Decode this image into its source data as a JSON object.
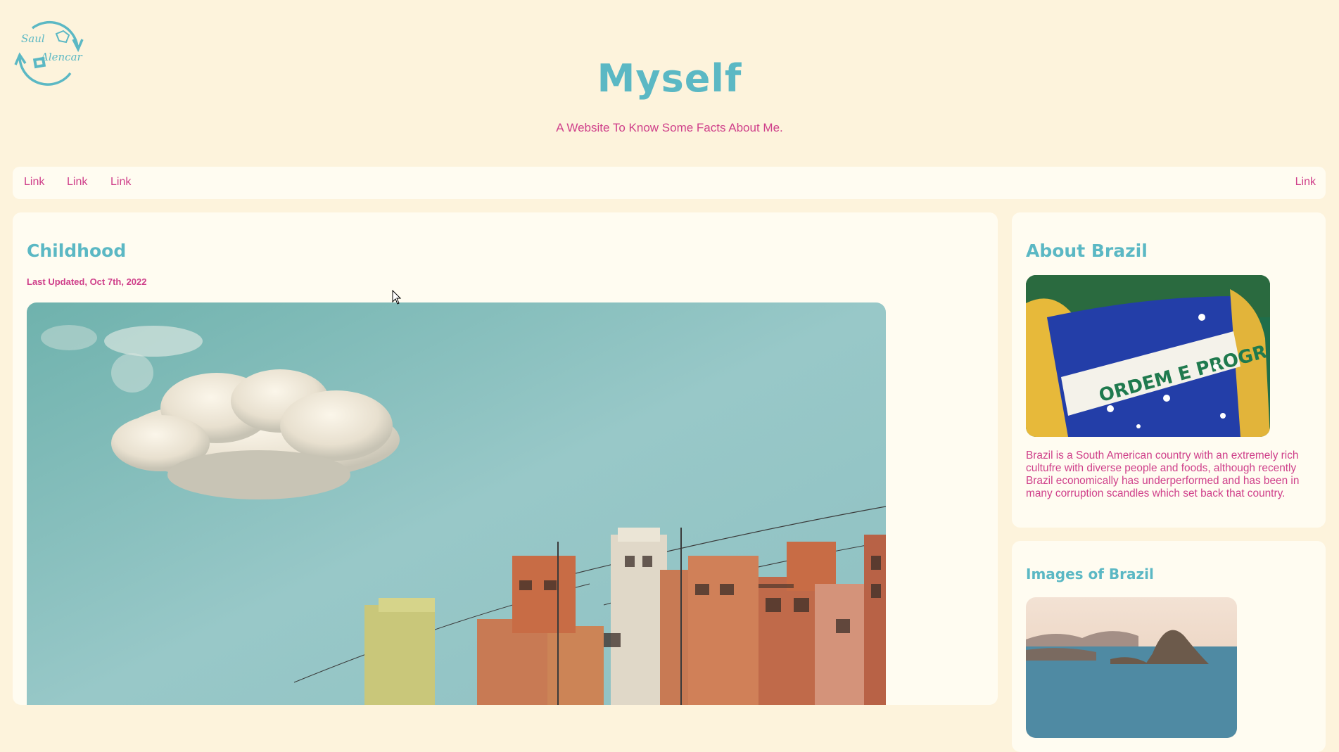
{
  "header": {
    "logo_text_top": "Saul",
    "logo_text_bottom": "Alencar",
    "title": "Myself",
    "subtitle": "A Website To Know Some Facts About Me."
  },
  "nav": {
    "links": [
      "Link",
      "Link",
      "Link"
    ],
    "right_link": "Link"
  },
  "main": {
    "title": "Childhood",
    "updated": "Last Updated, Oct 7th, 2022",
    "image": "hillside-houses-under-blue-sky-photo"
  },
  "sidebar": {
    "about": {
      "title": "About Brazil",
      "image": "brazilian-flag-photo",
      "flag_text": "ORDEM E PROGR",
      "text": "Brazil is a South American country with an extremely rich cultufre with diverse people and foods, although recently Brazil economically has underperformed and has been in many corruption scandles which set back that country."
    },
    "images": {
      "title": "Images of Brazil",
      "image": "rio-de-janeiro-bay-photo"
    }
  },
  "colors": {
    "background": "#fdf3dc",
    "card": "#fffcf1",
    "accent_teal": "#5bb8c4",
    "accent_pink": "#cf3f8a"
  }
}
